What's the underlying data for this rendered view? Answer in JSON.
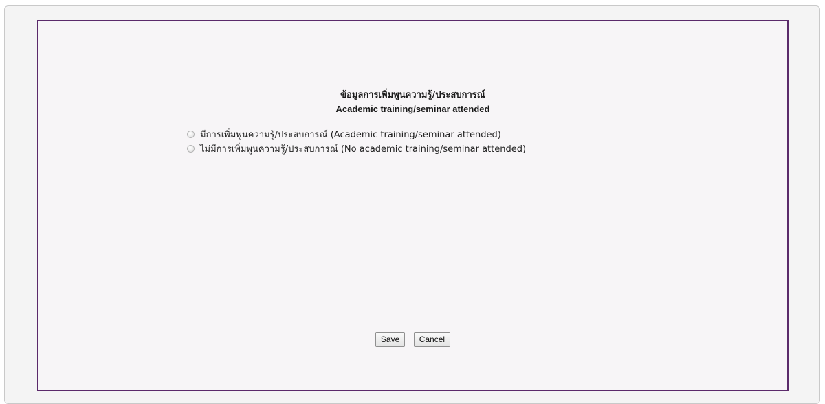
{
  "form": {
    "title_thai": "ข้อมูลการเพิ่มพูนความรู้/ประสบการณ์",
    "title_en": "Academic training/seminar attended",
    "options": [
      {
        "label": "มีการเพิ่มพูนความรู้/ประสบการณ์ (Academic training/seminar attended)",
        "selected": false
      },
      {
        "label": "ไม่มีการเพิ่มพูนความรู้/ประสบการณ์ (No academic training/seminar attended)",
        "selected": false
      }
    ],
    "save_label": "Save",
    "cancel_label": "Cancel"
  },
  "colors": {
    "frame_border": "#5b2a6b",
    "panel_background": "#f4f4f4"
  }
}
